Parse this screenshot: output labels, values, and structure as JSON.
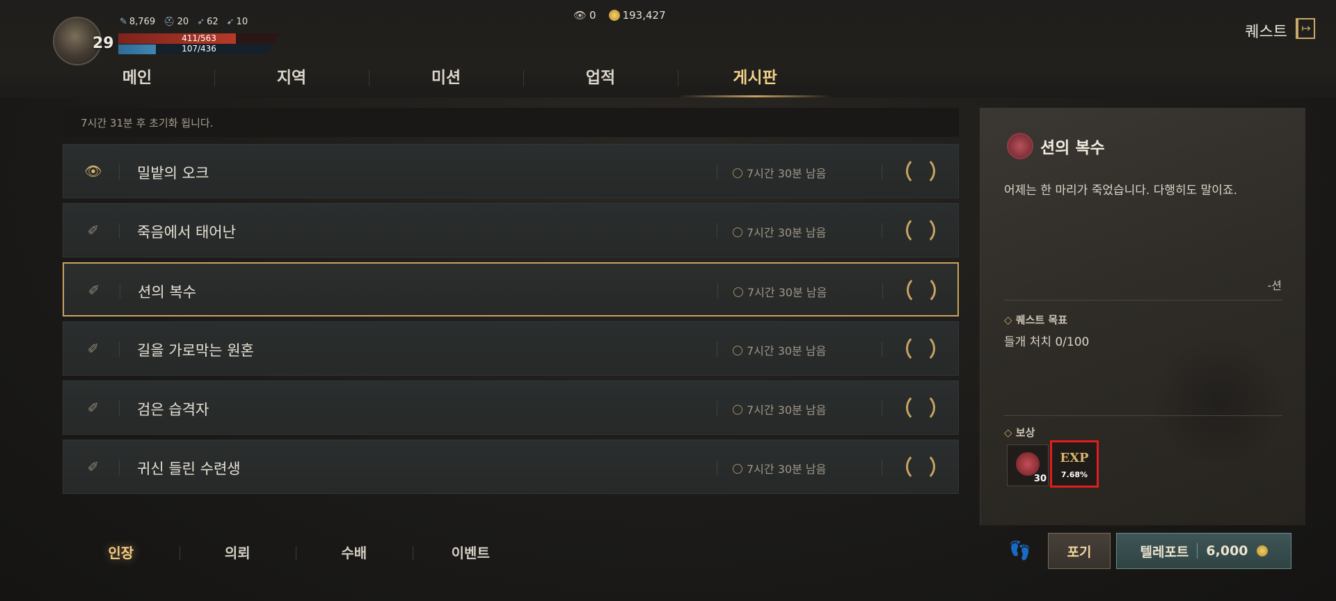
{
  "player": {
    "level": "29",
    "stats": [
      {
        "icon": "feather-icon",
        "value": "8,769"
      },
      {
        "icon": "helmet-icon",
        "value": "20"
      },
      {
        "icon": "wing-icon",
        "value": "62"
      },
      {
        "icon": "bird-icon",
        "value": "10"
      }
    ],
    "hp": "411/563",
    "hp_fraction": 0.73,
    "mp": "107/436",
    "mp_fraction": 0.245
  },
  "currency": {
    "gem": "0",
    "gold": "193,427"
  },
  "header": {
    "title": "퀘스트"
  },
  "tabs": [
    {
      "label": "메인"
    },
    {
      "label": "지역"
    },
    {
      "label": "미션"
    },
    {
      "label": "업적"
    },
    {
      "label": "게시판"
    }
  ],
  "notice": "7시간 31분 후 초기화 됩니다.",
  "quests": [
    {
      "name": "밀밭의 오크",
      "time": "7시간 30분 남음"
    },
    {
      "name": "죽음에서 태어난",
      "time": "7시간 30분 남음"
    },
    {
      "name": "션의 복수",
      "time": "7시간 30분 남음"
    },
    {
      "name": "길을 가로막는 원혼",
      "time": "7시간 30분 남음"
    },
    {
      "name": "검은 습격자",
      "time": "7시간 30분 남음"
    },
    {
      "name": "귀신 들린 수련생",
      "time": "7시간 30분 남음"
    }
  ],
  "subtabs": [
    {
      "label": "인장"
    },
    {
      "label": "의뢰"
    },
    {
      "label": "수배"
    },
    {
      "label": "이벤트"
    }
  ],
  "detail": {
    "title": "션의 복수",
    "description": "어제는 한 마리가 죽었습니다. 다행히도 말이죠.",
    "signature": "-션",
    "objective_heading": "퀘스트 목표",
    "objective": "들개 처치 0/100",
    "reward_heading": "보상",
    "reward_seal_count": "30",
    "reward_exp_label": "EXP",
    "reward_exp_pct": "7.68%"
  },
  "actions": {
    "give_up": "포기",
    "teleport": "텔레포트",
    "teleport_cost": "6,000"
  }
}
